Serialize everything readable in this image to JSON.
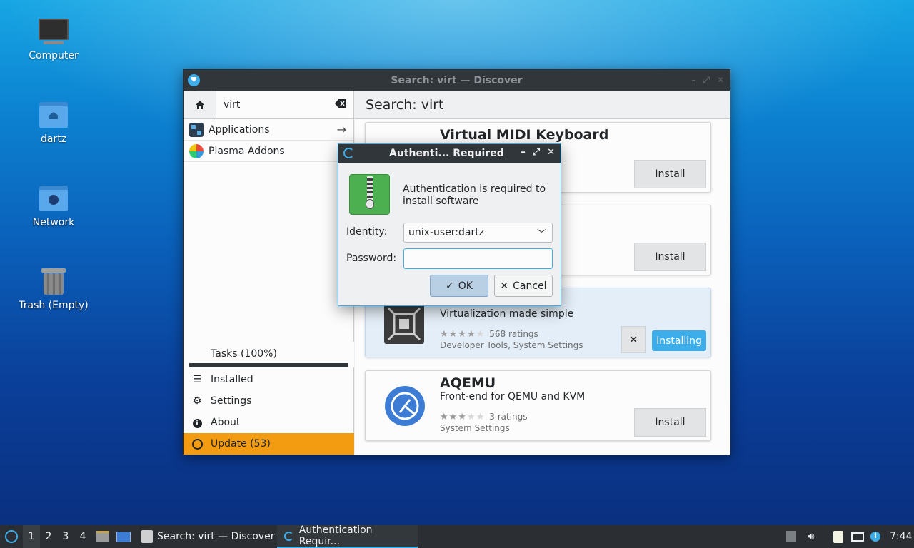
{
  "desktop": {
    "icons": [
      {
        "label": "Computer",
        "icon": "monitor-icon"
      },
      {
        "label": "dartz",
        "icon": "home-folder-icon"
      },
      {
        "label": "Network",
        "icon": "network-folder-icon"
      },
      {
        "label": "Trash (Empty)",
        "icon": "trash-icon"
      }
    ]
  },
  "window": {
    "title": "Search: virt — Discover",
    "search": {
      "value": "virt"
    },
    "categories": [
      {
        "label": "Applications",
        "icon": "applications-icon"
      },
      {
        "label": "Plasma Addons",
        "icon": "plasma-addons-icon"
      }
    ],
    "tasks": {
      "label": "Tasks (100%)",
      "progress": 1.0
    },
    "nav": [
      {
        "label": "Installed",
        "icon": "list-icon"
      },
      {
        "label": "Settings",
        "icon": "gear-icon"
      },
      {
        "label": "About",
        "icon": "info-icon"
      },
      {
        "label": "Update (53)",
        "icon": "update-icon"
      }
    ],
    "header": "Search: virt",
    "results": [
      {
        "name": "Virtual MIDI Keyboard",
        "button": "Install"
      },
      {
        "button": "Install"
      },
      {
        "description": "Virtualization made simple",
        "rating": 4,
        "ratings_text": "568 ratings",
        "categories": "Developer Tools, System Settings",
        "button": "Installing"
      },
      {
        "name": "AQEMU",
        "description": "Front-end for QEMU and KVM",
        "rating": 3,
        "ratings_text": "3 ratings",
        "categories": "System Settings",
        "button": "Install"
      }
    ]
  },
  "dialog": {
    "title": "Authenti... Required",
    "message": "Authentication is required to install software",
    "identity_label": "Identity:",
    "identity_value": "unix-user:dartz",
    "password_label": "Password:",
    "password_value": "",
    "ok": "OK",
    "cancel": "Cancel"
  },
  "taskbar": {
    "workspaces": [
      "1",
      "2",
      "3",
      "4"
    ],
    "active_workspace": "1",
    "tasks": [
      {
        "label": "Search: virt — Discover"
      },
      {
        "label": "Authentication Requir..."
      }
    ],
    "clock": "7:44"
  },
  "colors": {
    "accent": "#3daee9",
    "update": "#f39c12",
    "titlebar": "#31363b"
  }
}
